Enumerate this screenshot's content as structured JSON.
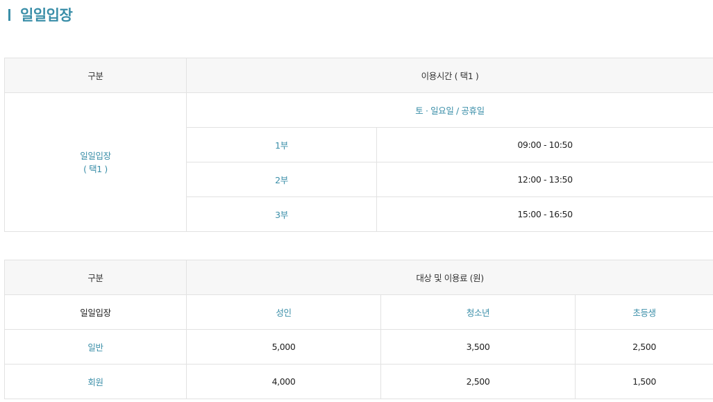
{
  "page_title": "일일입장",
  "schedule_table": {
    "header_category": "구분",
    "header_hours": "이용시간 ( 택1 )",
    "category_line1": "일일입장",
    "category_line2": "( 택1 )",
    "day_label": "토 · 일요일 / 공휴일",
    "sessions": [
      {
        "label": "1부",
        "time": "09:00 - 10:50"
      },
      {
        "label": "2부",
        "time": "12:00 - 13:50"
      },
      {
        "label": "3부",
        "time": "15:00 - 16:50"
      }
    ]
  },
  "fee_table": {
    "header_category": "구분",
    "header_fees": "대상 및 이용료 (원)",
    "subheader": {
      "category": "일일입장",
      "adult": "성인",
      "youth": "청소년",
      "child": "초등생"
    },
    "rows": [
      {
        "label": "일반",
        "adult": "5,000",
        "youth": "3,500",
        "child": "2,500"
      },
      {
        "label": "회원",
        "adult": "4,000",
        "youth": "2,500",
        "child": "1,500"
      }
    ]
  },
  "colors": {
    "accent": "#3a8ea8",
    "header_bg": "#f7f7f7",
    "border": "#e2e2e2"
  }
}
